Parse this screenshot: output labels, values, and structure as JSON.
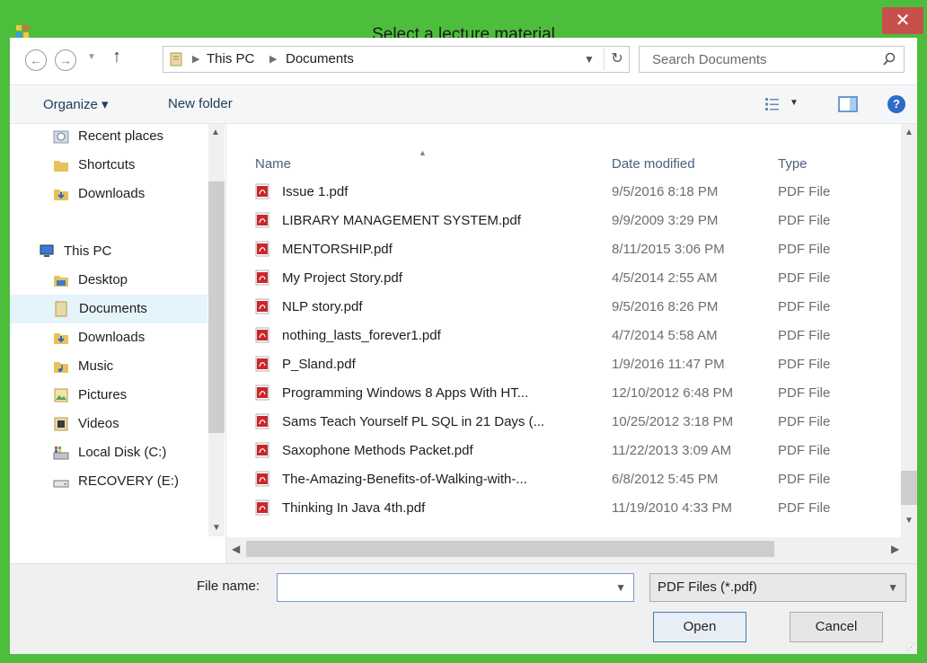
{
  "window": {
    "title": "Select a lecture material",
    "close_glyph": "✕"
  },
  "address": {
    "crumbs": [
      "This PC",
      "Documents"
    ],
    "search_placeholder": "Search Documents"
  },
  "toolbar": {
    "organize": "Organize ▾",
    "new_folder": "New folder"
  },
  "sidebar": {
    "items": [
      {
        "label": "Recent places",
        "icon": "recent-places-icon"
      },
      {
        "label": "Shortcuts",
        "icon": "folder-icon"
      },
      {
        "label": "Downloads",
        "icon": "downloads-icon"
      },
      {
        "label": "This PC",
        "icon": "computer-icon"
      },
      {
        "label": "Desktop",
        "icon": "desktop-icon"
      },
      {
        "label": "Documents",
        "icon": "documents-icon",
        "selected": true
      },
      {
        "label": "Downloads",
        "icon": "downloads-icon"
      },
      {
        "label": "Music",
        "icon": "music-icon"
      },
      {
        "label": "Pictures",
        "icon": "pictures-icon"
      },
      {
        "label": "Videos",
        "icon": "videos-icon"
      },
      {
        "label": "Local Disk (C:)",
        "icon": "local-disk-icon"
      },
      {
        "label": "RECOVERY (E:)",
        "icon": "drive-icon"
      }
    ]
  },
  "columns": {
    "name": "Name",
    "date": "Date modified",
    "type": "Type"
  },
  "files": [
    {
      "name": "Issue 1.pdf",
      "date": "9/5/2016 8:18 PM",
      "type": "PDF File"
    },
    {
      "name": "LIBRARY MANAGEMENT SYSTEM.pdf",
      "date": "9/9/2009 3:29 PM",
      "type": "PDF File"
    },
    {
      "name": "MENTORSHIP.pdf",
      "date": "8/11/2015 3:06 PM",
      "type": "PDF File"
    },
    {
      "name": "My Project Story.pdf",
      "date": "4/5/2014 2:55 AM",
      "type": "PDF File"
    },
    {
      "name": "NLP story.pdf",
      "date": "9/5/2016 8:26 PM",
      "type": "PDF File"
    },
    {
      "name": "nothing_lasts_forever1.pdf",
      "date": "4/7/2014 5:58 AM",
      "type": "PDF File"
    },
    {
      "name": "P_Sland.pdf",
      "date": "1/9/2016 11:47 PM",
      "type": "PDF File"
    },
    {
      "name": "Programming Windows 8 Apps With HT...",
      "date": "12/10/2012 6:48 PM",
      "type": "PDF File"
    },
    {
      "name": "Sams Teach Yourself PL SQL in 21 Days (...",
      "date": "10/25/2012 3:18 PM",
      "type": "PDF File"
    },
    {
      "name": "Saxophone Methods Packet.pdf",
      "date": "11/22/2013 3:09 AM",
      "type": "PDF File"
    },
    {
      "name": "The-Amazing-Benefits-of-Walking-with-...",
      "date": "6/8/2012 5:45 PM",
      "type": "PDF File"
    },
    {
      "name": "Thinking In Java 4th.pdf",
      "date": "11/19/2010 4:33 PM",
      "type": "PDF File"
    }
  ],
  "bottom": {
    "file_name_label": "File name:",
    "file_name_value": "",
    "filter": "PDF Files (*.pdf)",
    "open": "Open",
    "cancel": "Cancel"
  },
  "colors": {
    "frame": "#4dbe3c",
    "close": "#c7504a",
    "pdf": "#c8272d"
  }
}
